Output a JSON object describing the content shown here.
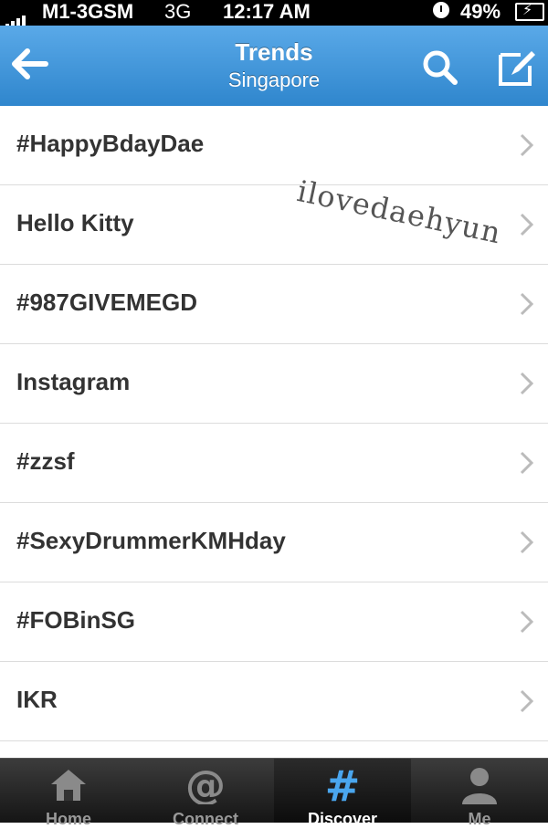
{
  "status_bar": {
    "carrier": "M1-3GSM",
    "network": "3G",
    "time": "12:17 AM",
    "battery": "49%"
  },
  "nav": {
    "title": "Trends",
    "subtitle": "Singapore",
    "back_icon": "back-arrow-icon",
    "search_icon": "search-icon",
    "compose_icon": "compose-icon"
  },
  "trends": [
    {
      "label": "#HappyBdayDae"
    },
    {
      "label": "Hello Kitty"
    },
    {
      "label": "#987GIVEMEGD"
    },
    {
      "label": "Instagram"
    },
    {
      "label": "#zzsf"
    },
    {
      "label": "#SexyDrummerKMHday"
    },
    {
      "label": "#FOBinSG"
    },
    {
      "label": "IKR"
    }
  ],
  "watermark": "ilovedaehyun",
  "tabs": [
    {
      "label": "Home",
      "icon": "home-icon",
      "active": false
    },
    {
      "label": "Connect",
      "icon": "at-sign-icon",
      "active": false
    },
    {
      "label": "Discover",
      "icon": "hashtag-icon",
      "active": true
    },
    {
      "label": "Me",
      "icon": "person-icon",
      "active": false
    }
  ],
  "colors": {
    "nav_blue": "#3a92d6",
    "active_tab_icon": "#4aa6ee",
    "text": "#333333"
  }
}
